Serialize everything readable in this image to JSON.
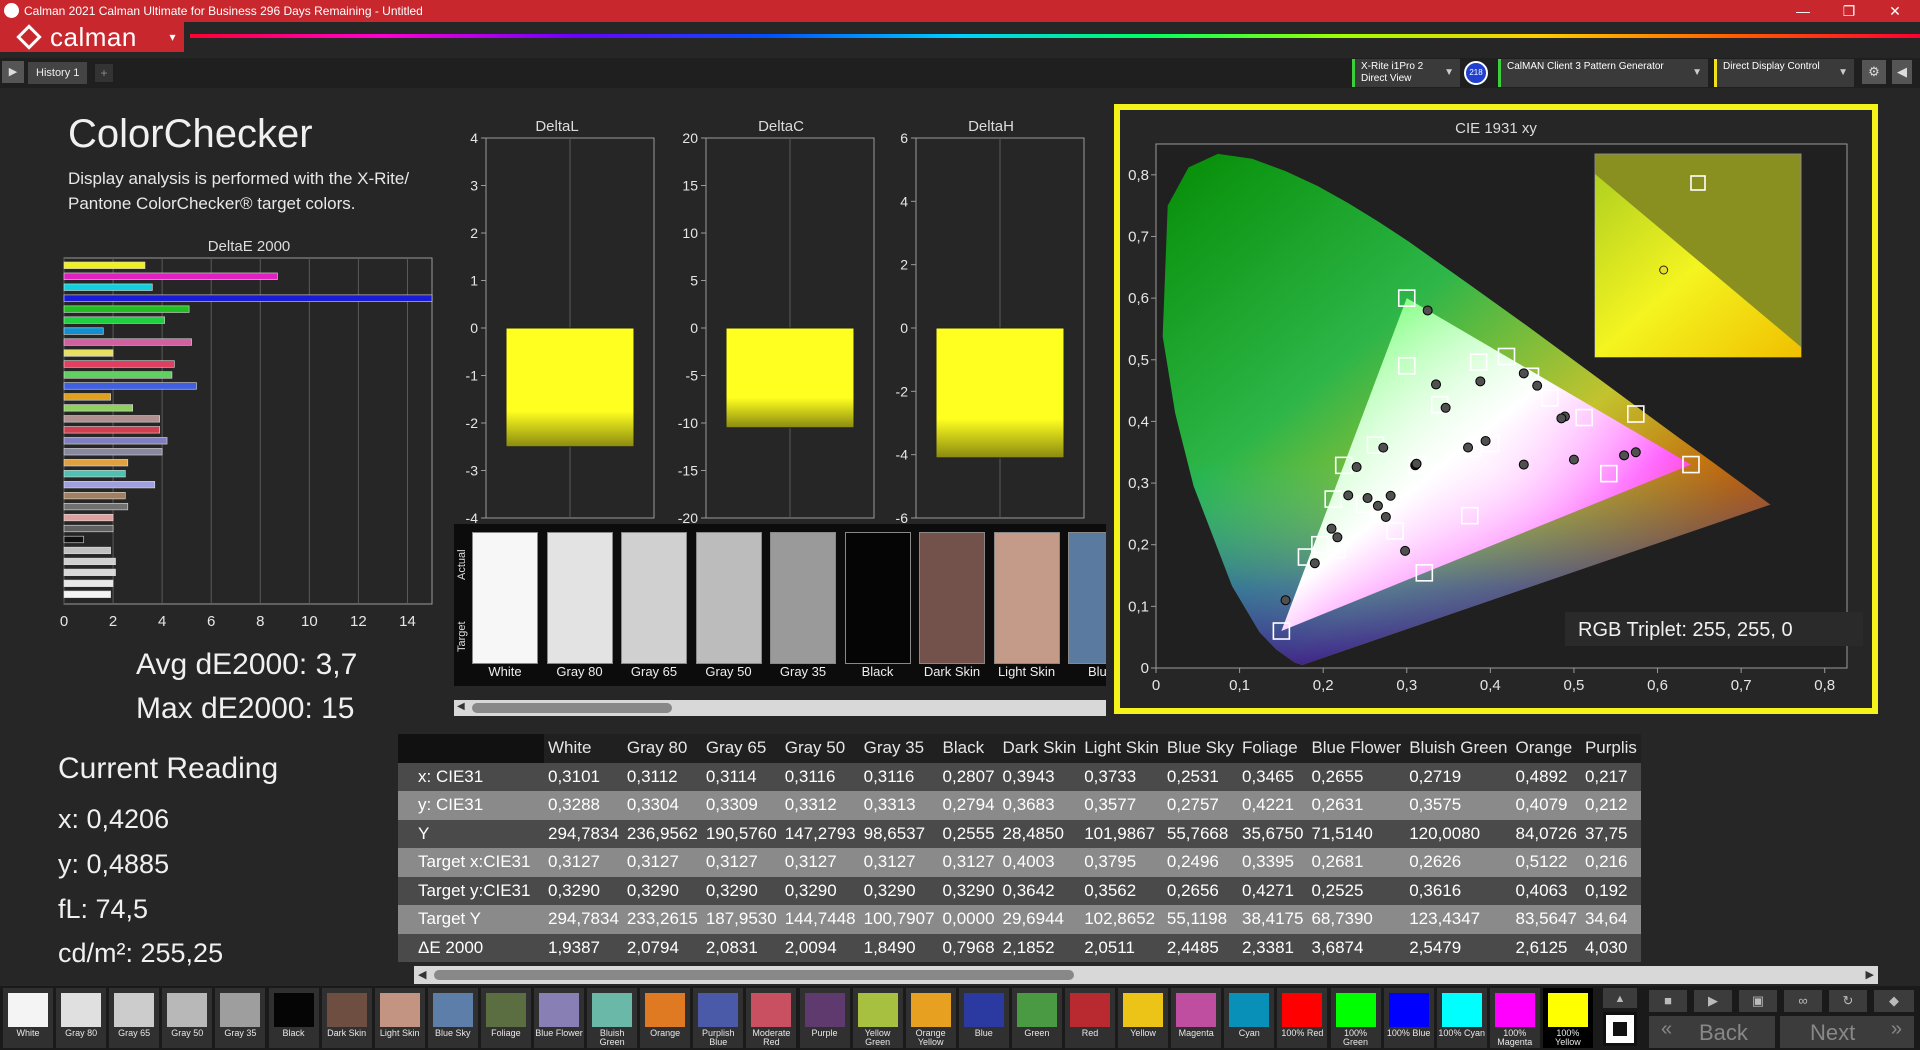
{
  "window": {
    "title": "Calman 2021 Calman Ultimate for Business 296 Days Remaining  - Untitled",
    "controls": [
      "—",
      "❐",
      "✕"
    ]
  },
  "brand": {
    "name": "calman",
    "menu_arrow": "▾"
  },
  "toolbar": {
    "play_icon": "play-icon",
    "history_tab": "History 1",
    "add_tab": "+",
    "meter": {
      "line1": "X-Rite i1Pro 2",
      "line2": "Direct View"
    },
    "badge": "218",
    "pattern_gen": "CalMAN Client 3 Pattern Generator",
    "display_control": "Direct Display Control",
    "settings_icon": "gear-icon",
    "collapse_icon": "chevron-left-icon"
  },
  "colorchecker": {
    "title": "ColorChecker",
    "description": "Display analysis is performed with the X-Rite/ Pantone ColorChecker® target colors.",
    "avg_de": "Avg dE2000: 3,7",
    "max_de": "Max dE2000: 15"
  },
  "current_reading": {
    "title": "Current Reading",
    "x": "x: 0,4206",
    "y": "y: 0,4885",
    "fl": "fL: 74,5",
    "cdm2": "cd/m²: 255,25"
  },
  "chart_data": [
    {
      "type": "bar",
      "title": "DeltaE 2000",
      "orientation": "horizontal",
      "xlim": [
        0,
        15
      ],
      "xticks": [
        "0",
        "2",
        "4",
        "6",
        "8",
        "10",
        "12",
        "14"
      ],
      "values": [
        3.3,
        8.7,
        3.6,
        15.0,
        5.1,
        4.1,
        1.6,
        5.2,
        2.0,
        4.5,
        4.4,
        5.4,
        1.9,
        2.8,
        3.9,
        3.9,
        4.2,
        4.0,
        2.6,
        2.5,
        3.7,
        2.5,
        2.6,
        2.0,
        2.0,
        0.8,
        1.9,
        2.1,
        2.1,
        2.0,
        1.9
      ],
      "colors": [
        "#f0f020",
        "#e020c0",
        "#10d0e0",
        "#1a1ad8",
        "#20c020",
        "#20d040",
        "#1090d0",
        "#d060a0",
        "#e8e060",
        "#e04060",
        "#60d060",
        "#4060e0",
        "#e0a020",
        "#90d060",
        "#b09090",
        "#d04050",
        "#8080c0",
        "#8888a0",
        "#e0a040",
        "#50c0b0",
        "#a0a0e0",
        "#a08060",
        "#707070",
        "#e0a0a0",
        "#606060",
        "#101010",
        "#c0c0c0",
        "#d0d0d0",
        "#d8d8d8",
        "#e8e8e8",
        "#f4f4f4"
      ]
    },
    {
      "type": "bar",
      "title": "DeltaL",
      "ylim": [
        -4,
        4
      ],
      "yticks": [
        "4",
        "3",
        "2",
        "1",
        "0",
        "-1",
        "-2",
        "-3",
        "-4"
      ],
      "values": [
        -2.5
      ],
      "colors": [
        "#ffff20"
      ]
    },
    {
      "type": "bar",
      "title": "DeltaC",
      "ylim": [
        -20,
        20
      ],
      "yticks": [
        "20",
        "15",
        "10",
        "5",
        "0",
        "-5",
        "-10",
        "-15",
        "-20"
      ],
      "values": [
        -10.5
      ],
      "colors": [
        "#ffff20"
      ]
    },
    {
      "type": "bar",
      "title": "DeltaH",
      "ylim": [
        -6,
        6
      ],
      "yticks": [
        "6",
        "4",
        "2",
        "0",
        "-2",
        "-4",
        "-6"
      ],
      "values": [
        -4.1
      ],
      "colors": [
        "#ffff20"
      ]
    },
    {
      "type": "scatter",
      "title": "CIE 1931 xy",
      "xlim": [
        0,
        0.85
      ],
      "ylim": [
        0,
        0.85
      ],
      "xticks": [
        "0",
        "0,1",
        "0,2",
        "0,3",
        "0,4",
        "0,5",
        "0,6",
        "0,7",
        "0,8"
      ],
      "yticks": [
        "0",
        "0,1",
        "0,2",
        "0,3",
        "0,4",
        "0,5",
        "0,6",
        "0,7",
        "0,8"
      ],
      "gamut": [
        [
          0.64,
          0.33
        ],
        [
          0.3,
          0.6
        ],
        [
          0.15,
          0.06
        ]
      ],
      "targets": [
        [
          0.3127,
          0.329
        ],
        [
          0.3127,
          0.329
        ],
        [
          0.3127,
          0.329
        ],
        [
          0.3127,
          0.329
        ],
        [
          0.3127,
          0.329
        ],
        [
          0.3127,
          0.329
        ],
        [
          0.4003,
          0.3642
        ],
        [
          0.3795,
          0.3562
        ],
        [
          0.2496,
          0.2656
        ],
        [
          0.3395,
          0.4271
        ],
        [
          0.2681,
          0.2525
        ],
        [
          0.2626,
          0.3616
        ],
        [
          0.5122,
          0.4063
        ],
        [
          0.216,
          0.192
        ],
        [
          0.64,
          0.33
        ],
        [
          0.3,
          0.6
        ],
        [
          0.15,
          0.06
        ],
        [
          0.2246,
          0.3287
        ],
        [
          0.321,
          0.1544
        ],
        [
          0.4193,
          0.5053
        ],
        [
          0.448,
          0.4732
        ],
        [
          0.4711,
          0.438
        ],
        [
          0.5417,
          0.3153
        ],
        [
          0.3754,
          0.2471
        ],
        [
          0.286,
          0.2224
        ],
        [
          0.18,
          0.18
        ],
        [
          0.196,
          0.2
        ],
        [
          0.212,
          0.274
        ],
        [
          0.3,
          0.49
        ],
        [
          0.386,
          0.496
        ],
        [
          0.574,
          0.412
        ]
      ],
      "actuals": [
        [
          0.3101,
          0.3288
        ],
        [
          0.3112,
          0.3304
        ],
        [
          0.3114,
          0.3309
        ],
        [
          0.3116,
          0.3312
        ],
        [
          0.3116,
          0.3313
        ],
        [
          0.2807,
          0.2794
        ],
        [
          0.3943,
          0.3683
        ],
        [
          0.3733,
          0.3577
        ],
        [
          0.2531,
          0.2757
        ],
        [
          0.3465,
          0.4221
        ],
        [
          0.2655,
          0.2631
        ],
        [
          0.2719,
          0.3575
        ],
        [
          0.4892,
          0.4079
        ],
        [
          0.217,
          0.212
        ],
        [
          0.574,
          0.35
        ],
        [
          0.325,
          0.58
        ],
        [
          0.155,
          0.11
        ],
        [
          0.24,
          0.326
        ],
        [
          0.298,
          0.19
        ],
        [
          0.44,
          0.478
        ],
        [
          0.456,
          0.458
        ],
        [
          0.485,
          0.405
        ],
        [
          0.5,
          0.338
        ],
        [
          0.44,
          0.33
        ],
        [
          0.275,
          0.245
        ],
        [
          0.19,
          0.17
        ],
        [
          0.21,
          0.226
        ],
        [
          0.23,
          0.28
        ],
        [
          0.335,
          0.46
        ],
        [
          0.388,
          0.465
        ],
        [
          0.56,
          0.345
        ]
      ],
      "inset_target": [
        0.43,
        0.52
      ],
      "inset_actual": [
        0.42,
        0.49
      ],
      "readout": "RGB Triplet: 255, 255, 0"
    }
  ],
  "swatch_strip": {
    "actual_label": "Actual",
    "target_label": "Target",
    "items": [
      {
        "label": "White",
        "color": "#f7f7f7"
      },
      {
        "label": "Gray 80",
        "color": "#e3e3e3"
      },
      {
        "label": "Gray 65",
        "color": "#d0d0d0"
      },
      {
        "label": "Gray 50",
        "color": "#bcbcbc"
      },
      {
        "label": "Gray 35",
        "color": "#9a9a9a"
      },
      {
        "label": "Black",
        "color": "#050505"
      },
      {
        "label": "Dark Skin",
        "color": "#72524a"
      },
      {
        "label": "Light Skin",
        "color": "#c49a88"
      },
      {
        "label": "Blue",
        "color": "#5b7aa0"
      }
    ]
  },
  "table": {
    "columns": [
      "White",
      "Gray 80",
      "Gray 65",
      "Gray 50",
      "Gray 35",
      "Black",
      "Dark Skin",
      "Light Skin",
      "Blue Sky",
      "Foliage",
      "Blue Flower",
      "Bluish Green",
      "Orange",
      "Purplis"
    ],
    "rows": [
      {
        "label": "x: CIE31",
        "values": [
          "0,3101",
          "0,3112",
          "0,3114",
          "0,3116",
          "0,3116",
          "0,2807",
          "0,3943",
          "0,3733",
          "0,2531",
          "0,3465",
          "0,2655",
          "0,2719",
          "0,4892",
          "0,217"
        ]
      },
      {
        "label": "y: CIE31",
        "values": [
          "0,3288",
          "0,3304",
          "0,3309",
          "0,3312",
          "0,3313",
          "0,2794",
          "0,3683",
          "0,3577",
          "0,2757",
          "0,4221",
          "0,2631",
          "0,3575",
          "0,4079",
          "0,212"
        ]
      },
      {
        "label": "Y",
        "values": [
          "294,7834",
          "236,9562",
          "190,5760",
          "147,2793",
          "98,6537",
          "0,2555",
          "28,4850",
          "101,9867",
          "55,7668",
          "35,6750",
          "71,5140",
          "120,0080",
          "84,0726",
          "37,75"
        ]
      },
      {
        "label": "Target x:CIE31",
        "values": [
          "0,3127",
          "0,3127",
          "0,3127",
          "0,3127",
          "0,3127",
          "0,3127",
          "0,4003",
          "0,3795",
          "0,2496",
          "0,3395",
          "0,2681",
          "0,2626",
          "0,5122",
          "0,216"
        ]
      },
      {
        "label": "Target y:CIE31",
        "values": [
          "0,3290",
          "0,3290",
          "0,3290",
          "0,3290",
          "0,3290",
          "0,3290",
          "0,3642",
          "0,3562",
          "0,2656",
          "0,4271",
          "0,2525",
          "0,3616",
          "0,4063",
          "0,192"
        ]
      },
      {
        "label": "Target Y",
        "values": [
          "294,7834",
          "233,2615",
          "187,9530",
          "144,7448",
          "100,7907",
          "0,0000",
          "29,6944",
          "102,8652",
          "55,1198",
          "38,4175",
          "68,7390",
          "123,4347",
          "83,5647",
          "34,64"
        ]
      },
      {
        "label": "ΔE 2000",
        "values": [
          "1,9387",
          "2,0794",
          "2,0831",
          "2,0094",
          "1,8490",
          "0,7968",
          "2,1852",
          "2,0511",
          "2,4485",
          "2,3381",
          "3,6874",
          "2,5479",
          "2,6125",
          "4,030"
        ]
      }
    ]
  },
  "patches": [
    {
      "label": "White",
      "color": "#f4f4f4"
    },
    {
      "label": "Gray 80",
      "color": "#e0e0e0"
    },
    {
      "label": "Gray 65",
      "color": "#cccccc"
    },
    {
      "label": "Gray 50",
      "color": "#b8b8b8"
    },
    {
      "label": "Gray 35",
      "color": "#9e9e9e"
    },
    {
      "label": "Black",
      "color": "#050505"
    },
    {
      "label": "Dark Skin",
      "color": "#6e4e40"
    },
    {
      "label": "Light Skin",
      "color": "#c49482"
    },
    {
      "label": "Blue Sky",
      "color": "#5e7eaa"
    },
    {
      "label": "Foliage",
      "color": "#5a6e42"
    },
    {
      "label": "Blue Flower",
      "color": "#8880b4"
    },
    {
      "label": "Bluish Green",
      "color": "#6ab8a8"
    },
    {
      "label": "Orange",
      "color": "#e07a22"
    },
    {
      "label": "Purplish Blue",
      "color": "#4a5aa8"
    },
    {
      "label": "Moderate Red",
      "color": "#c85060"
    },
    {
      "label": "Purple",
      "color": "#5e3a6e"
    },
    {
      "label": "Yellow Green",
      "color": "#a8c040"
    },
    {
      "label": "Orange Yellow",
      "color": "#e8a020"
    },
    {
      "label": "Blue",
      "color": "#2a3aa0"
    },
    {
      "label": "Green",
      "color": "#4a9a44"
    },
    {
      "label": "Red",
      "color": "#b82a30"
    },
    {
      "label": "Yellow",
      "color": "#ecc418"
    },
    {
      "label": "Magenta",
      "color": "#c04ea0"
    },
    {
      "label": "Cyan",
      "color": "#0890b8"
    },
    {
      "label": "100% Red",
      "color": "#ff0000"
    },
    {
      "label": "100% Green",
      "color": "#00ff00"
    },
    {
      "label": "100% Blue",
      "color": "#0000ff"
    },
    {
      "label": "100% Cyan",
      "color": "#00ffff"
    },
    {
      "label": "100% Magenta",
      "color": "#ff00ff"
    },
    {
      "label": "100% Yellow",
      "color": "#ffff00"
    }
  ],
  "nav": {
    "back": "Back",
    "next": "Next",
    "control_icons": [
      "up-icon",
      "stop-icon",
      "play-icon",
      "save-icon",
      "link-icon",
      "refresh-icon"
    ]
  }
}
